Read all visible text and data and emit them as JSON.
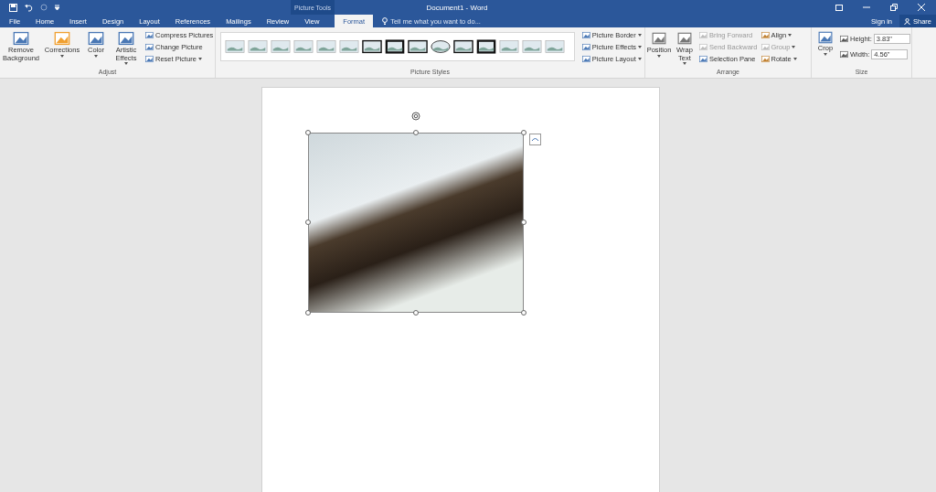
{
  "window": {
    "title": "Document1 - Word",
    "context_label": "Picture Tools"
  },
  "tabs": [
    {
      "label": "File",
      "selected": false
    },
    {
      "label": "Home",
      "selected": false
    },
    {
      "label": "Insert",
      "selected": false
    },
    {
      "label": "Design",
      "selected": false
    },
    {
      "label": "Layout",
      "selected": false
    },
    {
      "label": "References",
      "selected": false
    },
    {
      "label": "Mailings",
      "selected": false
    },
    {
      "label": "Review",
      "selected": false
    },
    {
      "label": "View",
      "selected": false
    },
    {
      "label": "Format",
      "selected": true
    }
  ],
  "tell_me": {
    "placeholder": "Tell me what you want to do..."
  },
  "account": {
    "sign_in": "Sign in",
    "share": "Share"
  },
  "adjust": {
    "label": "Adjust",
    "big": [
      {
        "label": "Remove Background",
        "dropdown": false
      },
      {
        "label": "Corrections",
        "dropdown": true
      },
      {
        "label": "Color",
        "dropdown": true
      },
      {
        "label": "Artistic Effects",
        "dropdown": true
      }
    ],
    "small": [
      {
        "label": "Compress Pictures",
        "dropdown": false
      },
      {
        "label": "Change Picture",
        "dropdown": false
      },
      {
        "label": "Reset Picture",
        "dropdown": true
      }
    ]
  },
  "picture_styles": {
    "label": "Picture Styles",
    "commands": [
      {
        "label": "Picture Border"
      },
      {
        "label": "Picture Effects"
      },
      {
        "label": "Picture Layout"
      }
    ]
  },
  "arrange": {
    "label": "Arrange",
    "big": [
      {
        "label": "Position"
      },
      {
        "label": "Wrap Text"
      }
    ],
    "small": [
      {
        "label": "Bring Forward",
        "disabled": true
      },
      {
        "label": "Send Backward",
        "disabled": true
      },
      {
        "label": "Selection Pane",
        "disabled": false
      }
    ],
    "right": [
      {
        "label": "Align",
        "disabled": false
      },
      {
        "label": "Group",
        "disabled": true
      },
      {
        "label": "Rotate",
        "disabled": false
      }
    ]
  },
  "size": {
    "label": "Size",
    "crop": "Crop",
    "fields": [
      {
        "label": "Height:",
        "value": "3.83\""
      },
      {
        "label": "Width:",
        "value": "4.56\""
      }
    ]
  }
}
